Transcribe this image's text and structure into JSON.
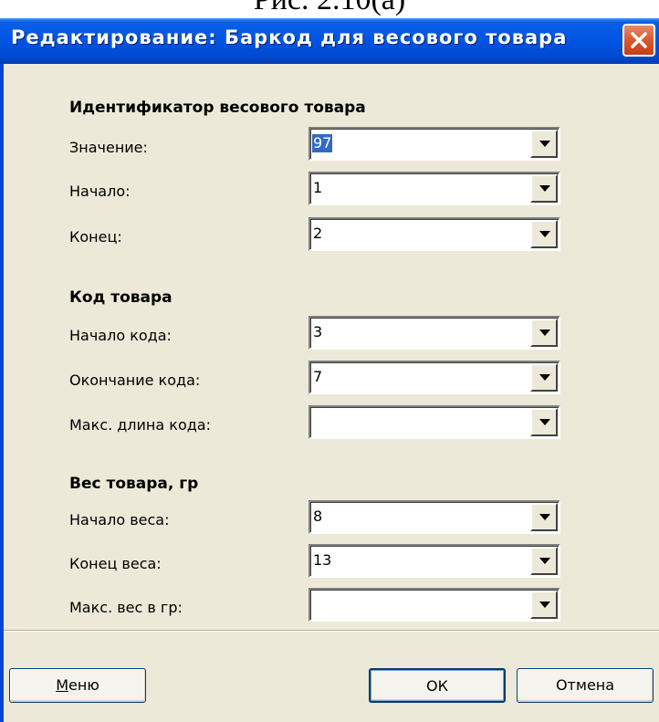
{
  "caption": "Рис. 2.10(а)",
  "window": {
    "title": "Редактирование: Баркод для весового товара"
  },
  "sections": [
    {
      "title": "Идентификатор весового товара",
      "fields": [
        {
          "label": "Значение:",
          "value": "97",
          "selected": true
        },
        {
          "label": "Начало:",
          "value": "1"
        },
        {
          "label": "Конец:",
          "value": "2"
        }
      ]
    },
    {
      "title": "Код товара",
      "fields": [
        {
          "label": "Начало кода:",
          "value": "3"
        },
        {
          "label": "Окончание кода:",
          "value": "7"
        },
        {
          "label": "Макс. длина кода:",
          "value": ""
        }
      ]
    },
    {
      "title": "Вес товара, гр",
      "fields": [
        {
          "label": "Начало веса:",
          "value": "8"
        },
        {
          "label": "Конец веса:",
          "value": "13"
        },
        {
          "label": "Макс. вес в гр:",
          "value": ""
        }
      ]
    }
  ],
  "buttons": {
    "menu": "Меню",
    "ok": "ОК",
    "cancel": "Отмена"
  },
  "icons": {
    "close": "close-icon",
    "dropdown": "chevron-down-icon"
  },
  "colors": {
    "titlebar": "#0054e3",
    "dialog_bg": "#ece9d8",
    "selection": "#316ac5",
    "close_button": "#d9582f"
  }
}
